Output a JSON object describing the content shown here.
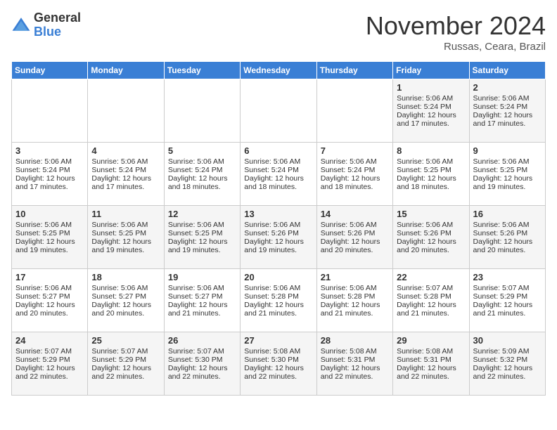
{
  "logo": {
    "general": "General",
    "blue": "Blue"
  },
  "title": "November 2024",
  "location": "Russas, Ceara, Brazil",
  "days_of_week": [
    "Sunday",
    "Monday",
    "Tuesday",
    "Wednesday",
    "Thursday",
    "Friday",
    "Saturday"
  ],
  "weeks": [
    [
      {
        "day": "",
        "info": ""
      },
      {
        "day": "",
        "info": ""
      },
      {
        "day": "",
        "info": ""
      },
      {
        "day": "",
        "info": ""
      },
      {
        "day": "",
        "info": ""
      },
      {
        "day": "1",
        "info": "Sunrise: 5:06 AM\nSunset: 5:24 PM\nDaylight: 12 hours and 17 minutes."
      },
      {
        "day": "2",
        "info": "Sunrise: 5:06 AM\nSunset: 5:24 PM\nDaylight: 12 hours and 17 minutes."
      }
    ],
    [
      {
        "day": "3",
        "info": "Sunrise: 5:06 AM\nSunset: 5:24 PM\nDaylight: 12 hours and 17 minutes."
      },
      {
        "day": "4",
        "info": "Sunrise: 5:06 AM\nSunset: 5:24 PM\nDaylight: 12 hours and 17 minutes."
      },
      {
        "day": "5",
        "info": "Sunrise: 5:06 AM\nSunset: 5:24 PM\nDaylight: 12 hours and 18 minutes."
      },
      {
        "day": "6",
        "info": "Sunrise: 5:06 AM\nSunset: 5:24 PM\nDaylight: 12 hours and 18 minutes."
      },
      {
        "day": "7",
        "info": "Sunrise: 5:06 AM\nSunset: 5:24 PM\nDaylight: 12 hours and 18 minutes."
      },
      {
        "day": "8",
        "info": "Sunrise: 5:06 AM\nSunset: 5:25 PM\nDaylight: 12 hours and 18 minutes."
      },
      {
        "day": "9",
        "info": "Sunrise: 5:06 AM\nSunset: 5:25 PM\nDaylight: 12 hours and 19 minutes."
      }
    ],
    [
      {
        "day": "10",
        "info": "Sunrise: 5:06 AM\nSunset: 5:25 PM\nDaylight: 12 hours and 19 minutes."
      },
      {
        "day": "11",
        "info": "Sunrise: 5:06 AM\nSunset: 5:25 PM\nDaylight: 12 hours and 19 minutes."
      },
      {
        "day": "12",
        "info": "Sunrise: 5:06 AM\nSunset: 5:25 PM\nDaylight: 12 hours and 19 minutes."
      },
      {
        "day": "13",
        "info": "Sunrise: 5:06 AM\nSunset: 5:26 PM\nDaylight: 12 hours and 19 minutes."
      },
      {
        "day": "14",
        "info": "Sunrise: 5:06 AM\nSunset: 5:26 PM\nDaylight: 12 hours and 20 minutes."
      },
      {
        "day": "15",
        "info": "Sunrise: 5:06 AM\nSunset: 5:26 PM\nDaylight: 12 hours and 20 minutes."
      },
      {
        "day": "16",
        "info": "Sunrise: 5:06 AM\nSunset: 5:26 PM\nDaylight: 12 hours and 20 minutes."
      }
    ],
    [
      {
        "day": "17",
        "info": "Sunrise: 5:06 AM\nSunset: 5:27 PM\nDaylight: 12 hours and 20 minutes."
      },
      {
        "day": "18",
        "info": "Sunrise: 5:06 AM\nSunset: 5:27 PM\nDaylight: 12 hours and 20 minutes."
      },
      {
        "day": "19",
        "info": "Sunrise: 5:06 AM\nSunset: 5:27 PM\nDaylight: 12 hours and 21 minutes."
      },
      {
        "day": "20",
        "info": "Sunrise: 5:06 AM\nSunset: 5:28 PM\nDaylight: 12 hours and 21 minutes."
      },
      {
        "day": "21",
        "info": "Sunrise: 5:06 AM\nSunset: 5:28 PM\nDaylight: 12 hours and 21 minutes."
      },
      {
        "day": "22",
        "info": "Sunrise: 5:07 AM\nSunset: 5:28 PM\nDaylight: 12 hours and 21 minutes."
      },
      {
        "day": "23",
        "info": "Sunrise: 5:07 AM\nSunset: 5:29 PM\nDaylight: 12 hours and 21 minutes."
      }
    ],
    [
      {
        "day": "24",
        "info": "Sunrise: 5:07 AM\nSunset: 5:29 PM\nDaylight: 12 hours and 22 minutes."
      },
      {
        "day": "25",
        "info": "Sunrise: 5:07 AM\nSunset: 5:29 PM\nDaylight: 12 hours and 22 minutes."
      },
      {
        "day": "26",
        "info": "Sunrise: 5:07 AM\nSunset: 5:30 PM\nDaylight: 12 hours and 22 minutes."
      },
      {
        "day": "27",
        "info": "Sunrise: 5:08 AM\nSunset: 5:30 PM\nDaylight: 12 hours and 22 minutes."
      },
      {
        "day": "28",
        "info": "Sunrise: 5:08 AM\nSunset: 5:31 PM\nDaylight: 12 hours and 22 minutes."
      },
      {
        "day": "29",
        "info": "Sunrise: 5:08 AM\nSunset: 5:31 PM\nDaylight: 12 hours and 22 minutes."
      },
      {
        "day": "30",
        "info": "Sunrise: 5:09 AM\nSunset: 5:32 PM\nDaylight: 12 hours and 22 minutes."
      }
    ]
  ]
}
